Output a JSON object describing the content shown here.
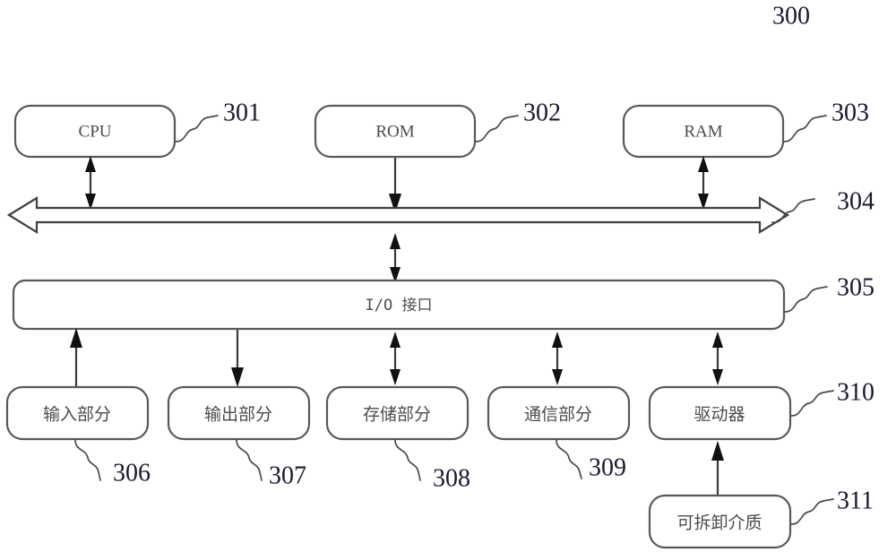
{
  "figure": {
    "figure_number": "300",
    "background_color": "#ffffff",
    "line_color": "#595959",
    "text_color": "#4b4b4b",
    "ref_color": "#1a1a2e"
  },
  "blocks": {
    "cpu": {
      "label": "CPU",
      "ref": "301"
    },
    "rom": {
      "label": "ROM",
      "ref": "302"
    },
    "ram": {
      "label": "RAM",
      "ref": "303"
    },
    "bus": {
      "label": "",
      "ref": "304"
    },
    "io": {
      "label": "I/O 接口",
      "ref": "305"
    },
    "input": {
      "label": "输入部分",
      "ref": "306"
    },
    "output": {
      "label": "输出部分",
      "ref": "307"
    },
    "storage": {
      "label": "存储部分",
      "ref": "308"
    },
    "comm": {
      "label": "通信部分",
      "ref": "309"
    },
    "driver": {
      "label": "驱动器",
      "ref": "310"
    },
    "media": {
      "label": "可拆卸介质",
      "ref": "311"
    }
  },
  "connections": [
    {
      "from": "cpu",
      "to": "bus",
      "type": "bidirectional"
    },
    {
      "from": "rom",
      "to": "bus",
      "type": "downward"
    },
    {
      "from": "ram",
      "to": "bus",
      "type": "bidirectional"
    },
    {
      "from": "bus",
      "to": "io",
      "type": "bidirectional"
    },
    {
      "from": "io",
      "to": "input",
      "type": "upward"
    },
    {
      "from": "io",
      "to": "output",
      "type": "downward"
    },
    {
      "from": "io",
      "to": "storage",
      "type": "bidirectional"
    },
    {
      "from": "io",
      "to": "comm",
      "type": "bidirectional"
    },
    {
      "from": "io",
      "to": "driver",
      "type": "bidirectional"
    },
    {
      "from": "media",
      "to": "driver",
      "type": "upward"
    }
  ]
}
